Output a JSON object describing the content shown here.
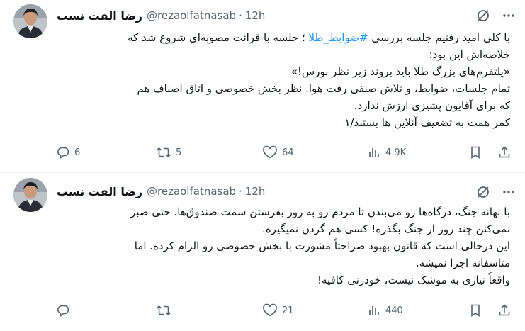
{
  "tweets": [
    {
      "author_name": "رضا الفت نسب",
      "handle": "@rezaolfatnasab",
      "separator": "·",
      "time": "12h",
      "lines_before_hashtag": "با کلی امید رفتیم جلسه بررسی",
      "hashtag": "#ضوابط_طلا",
      "line1_after": "؛ جلسه با قرائت مصوبه‌ای شروع شد که",
      "lines": [
        "خلاصه‌اش این بود:",
        "«پلتفرم‌های بزرگ طلا باید بروند زیر نظر بورس!»",
        "تمام جلسات، ضوابط، و تلاش صنفی رفت هوا. نظر بخش خصوصی و اتاق اصناف هم",
        "که برای آقایون پشیزی ارزش ندارد.",
        "کمر همت به تضعیف آنلاین ها بستند/۱"
      ],
      "replies": "6",
      "reposts": "5",
      "likes": "64",
      "views": "4.9K"
    },
    {
      "author_name": "رضا الفت نسب",
      "handle": "@rezaolfatnasab",
      "separator": "·",
      "time": "12h",
      "lines": [
        "با بهانه جنگ، درگاه‌ها رو می‌بندن تا مردم رو به زور بفرستن سمت صندوق‌ها. حتی صبر",
        "نمی‌کنن چند روز از جنگ بگذره! کسی هم گردن نمیگیره.",
        "این درحالی است که قانون بهبود صراحتاً مشورت با بخش خصوصی رو الزام کرده. اما",
        "متاسفانه اجرا نمیشه.",
        "واقعاً نیازی به موشک نیست، خودزنی کافیه!"
      ],
      "replies": "",
      "reposts": "",
      "likes": "21",
      "views": "440"
    }
  ],
  "icons": {
    "grok": "grok-icon",
    "more": "more-icon",
    "reply": "reply-icon",
    "retweet": "retweet-icon",
    "like": "heart-icon",
    "views": "views-icon",
    "bookmark": "bookmark-icon",
    "share": "share-icon"
  },
  "colors": {
    "text": "#0f1419",
    "secondary": "#536471",
    "hashtag": "#1d9bf0",
    "divider": "#eff3f4"
  }
}
